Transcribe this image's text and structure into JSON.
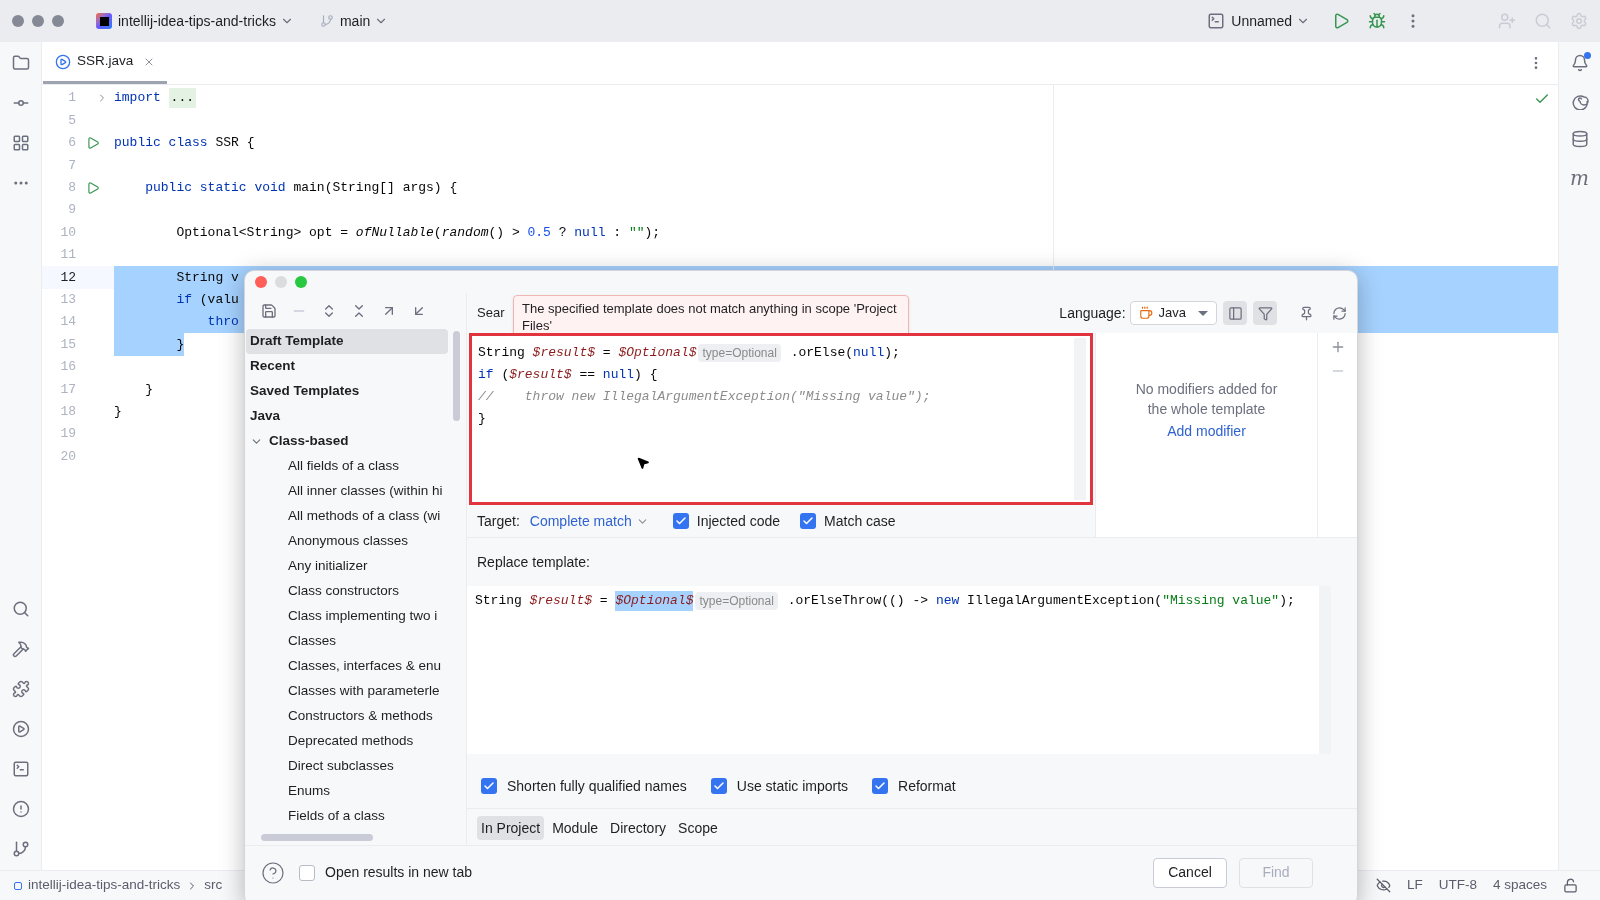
{
  "titlebar": {
    "project": "intellij-idea-tips-and-tricks",
    "branch": "main",
    "run_config": "Unnamed"
  },
  "right_toolbar": {
    "maven_label": "m",
    "notification": true
  },
  "editor_tab": {
    "label": "SSR.java",
    "selected": true
  },
  "editor_lines": [
    {
      "number": "1",
      "current": false,
      "selected": false,
      "kind": "fold",
      "tokens": [
        {
          "kind": "keyword",
          "text": "import "
        },
        {
          "kind": "fold",
          "text": "..."
        }
      ]
    },
    {
      "number": "5",
      "current": false,
      "selected": false,
      "kind": "code"
    },
    {
      "number": "6",
      "current": false,
      "selected": false,
      "kind": "run",
      "tokens": [
        {
          "kind": "keyword",
          "text": "public class "
        },
        {
          "kind": "plain",
          "text": "SSR {"
        }
      ]
    },
    {
      "number": "7",
      "current": false,
      "selected": false,
      "kind": "code"
    },
    {
      "number": "8",
      "current": false,
      "selected": false,
      "kind": "run",
      "tokens": [
        {
          "kind": "keyword",
          "text": "    public static void "
        },
        {
          "kind": "plain",
          "text": "main(String[] args) {"
        }
      ]
    },
    {
      "number": "9",
      "current": false,
      "selected": false,
      "kind": "code"
    },
    {
      "number": "10",
      "current": false,
      "selected": false,
      "kind": "code",
      "tokens": [
        {
          "kind": "plain",
          "text": "        Optional<String> opt = "
        },
        {
          "kind": "italic",
          "text": "ofNullable"
        },
        {
          "kind": "plain",
          "text": "("
        },
        {
          "kind": "italic",
          "text": "random"
        },
        {
          "kind": "plain",
          "text": "() > "
        },
        {
          "kind": "number",
          "text": "0.5"
        },
        {
          "kind": "plain",
          "text": " ? "
        },
        {
          "kind": "keyword",
          "text": "null"
        },
        {
          "kind": "plain",
          "text": " : "
        },
        {
          "kind": "string",
          "text": "\"\""
        },
        {
          "kind": "plain",
          "text": ");"
        }
      ]
    },
    {
      "number": "11",
      "current": false,
      "selected": false,
      "kind": "code"
    },
    {
      "number": "12",
      "current": true,
      "selected": true,
      "kind": "code",
      "tokens": [
        {
          "kind": "plain",
          "text": "        String v"
        }
      ]
    },
    {
      "number": "13",
      "current": false,
      "selected": true,
      "kind": "code",
      "tokens": [
        {
          "kind": "keyword",
          "text": "        if"
        },
        {
          "kind": "plain",
          "text": " (valu"
        }
      ]
    },
    {
      "number": "14",
      "current": false,
      "selected": true,
      "kind": "code",
      "tokens": [
        {
          "kind": "keyword",
          "text": "            thro"
        }
      ]
    },
    {
      "number": "15",
      "current": false,
      "selected": true,
      "kind": "code",
      "tokens": [
        {
          "kind": "plain",
          "text": "        }"
        }
      ]
    },
    {
      "number": "16",
      "current": false,
      "selected": false,
      "kind": "code"
    },
    {
      "number": "17",
      "current": false,
      "selected": false,
      "kind": "code",
      "tokens": [
        {
          "kind": "plain",
          "text": "    }"
        }
      ]
    },
    {
      "number": "18",
      "current": false,
      "selected": false,
      "kind": "code",
      "tokens": [
        {
          "kind": "plain",
          "text": "}"
        }
      ]
    },
    {
      "number": "19",
      "current": false,
      "selected": false,
      "kind": "code"
    },
    {
      "number": "20",
      "current": false,
      "selected": false,
      "kind": "code"
    }
  ],
  "status_bar": {
    "breadcrumbs": [
      "intellij-idea-tips-and-tricks",
      "src"
    ],
    "line_separator": "LF",
    "encoding": "UTF-8",
    "indent": "4 spaces"
  },
  "dialog": {
    "tree": [
      {
        "label": "Draft Template",
        "selected": true
      },
      {
        "label": "Recent",
        "selected": false
      },
      {
        "label": "Saved Templates",
        "selected": false
      },
      {
        "label": "Java",
        "selected": false,
        "children": [
          {
            "label": "Class-based",
            "selected": false,
            "expanded": true,
            "children": [
              {
                "label": "All fields of a class",
                "selected": false
              },
              {
                "label": "All inner classes (within hi",
                "selected": false
              },
              {
                "label": "All methods of a class (wi",
                "selected": false
              },
              {
                "label": "Anonymous classes",
                "selected": false
              },
              {
                "label": "Any initializer",
                "selected": false
              },
              {
                "label": "Class constructors",
                "selected": false
              },
              {
                "label": "Class implementing two i",
                "selected": false
              },
              {
                "label": "Classes",
                "selected": false
              },
              {
                "label": "Classes, interfaces & enu",
                "selected": false
              },
              {
                "label": "Classes with parameterle",
                "selected": false
              },
              {
                "label": "Constructors & methods",
                "selected": false
              },
              {
                "label": "Deprecated methods",
                "selected": false
              },
              {
                "label": "Direct subclasses",
                "selected": false
              },
              {
                "label": "Enums",
                "selected": false
              },
              {
                "label": "Fields of a class",
                "selected": false
              }
            ]
          }
        ]
      }
    ],
    "search_label": "Sear",
    "tooltip": "The specified template does not match anything in scope 'Project Files'",
    "language_label": "Language:",
    "language": "Java",
    "search_template": {
      "error": true,
      "lines": [
        [
          {
            "kind": "plain",
            "text": "String "
          },
          {
            "kind": "variable",
            "text": "$result$"
          },
          {
            "kind": "plain",
            "text": " = "
          },
          {
            "kind": "variable",
            "text": "$Optional$"
          },
          {
            "kind": "inlay",
            "text": "type=Optional"
          },
          {
            "kind": "plain",
            "text": " .orElse("
          },
          {
            "kind": "keyword",
            "text": "null"
          },
          {
            "kind": "plain",
            "text": ");"
          }
        ],
        [
          {
            "kind": "keyword",
            "text": "if"
          },
          {
            "kind": "plain",
            "text": " ("
          },
          {
            "kind": "variable",
            "text": "$result$"
          },
          {
            "kind": "plain",
            "text": " == "
          },
          {
            "kind": "keyword",
            "text": "null"
          },
          {
            "kind": "plain",
            "text": ") {"
          }
        ],
        [
          {
            "kind": "comment",
            "text": "//    throw new IllegalArgumentException(\"Missing value\");"
          }
        ],
        [
          {
            "kind": "plain",
            "text": "}"
          }
        ]
      ]
    },
    "modifiers_text": "No modifiers added for the whole template",
    "add_modifier": "Add modifier",
    "target_label": "Target:",
    "target": "Complete match",
    "search_options": [
      {
        "label": "Injected code",
        "checked": true
      },
      {
        "label": "Match case",
        "checked": true
      }
    ],
    "replace_label": "Replace template:",
    "replace_template": {
      "lines": [
        [
          {
            "kind": "plain",
            "text": "String "
          },
          {
            "kind": "variable",
            "text": "$result$"
          },
          {
            "kind": "plain",
            "text": " = "
          },
          {
            "kind": "variable-selected",
            "text": "$Optional$"
          },
          {
            "kind": "inlay",
            "text": "type=Optional"
          },
          {
            "kind": "plain",
            "text": " .orElseThrow(() -> "
          },
          {
            "kind": "keyword",
            "text": "new"
          },
          {
            "kind": "plain",
            "text": " IllegalArgumentException("
          },
          {
            "kind": "string",
            "text": "\"Missing value\""
          },
          {
            "kind": "plain",
            "text": ");"
          }
        ]
      ]
    },
    "replace_options": [
      {
        "label": "Shorten fully qualified names",
        "checked": true
      },
      {
        "label": "Use static imports",
        "checked": true
      },
      {
        "label": "Reformat",
        "checked": true
      }
    ],
    "scopes": [
      {
        "label": "In Project",
        "selected": true
      },
      {
        "label": "Module",
        "selected": false
      },
      {
        "label": "Directory",
        "selected": false
      },
      {
        "label": "Scope",
        "selected": false
      }
    ],
    "open_in_new_tab": {
      "label": "Open results in new tab",
      "checked": false
    },
    "buttons": [
      {
        "label": "Cancel",
        "disabled": false
      },
      {
        "label": "Find",
        "disabled": true
      }
    ]
  }
}
